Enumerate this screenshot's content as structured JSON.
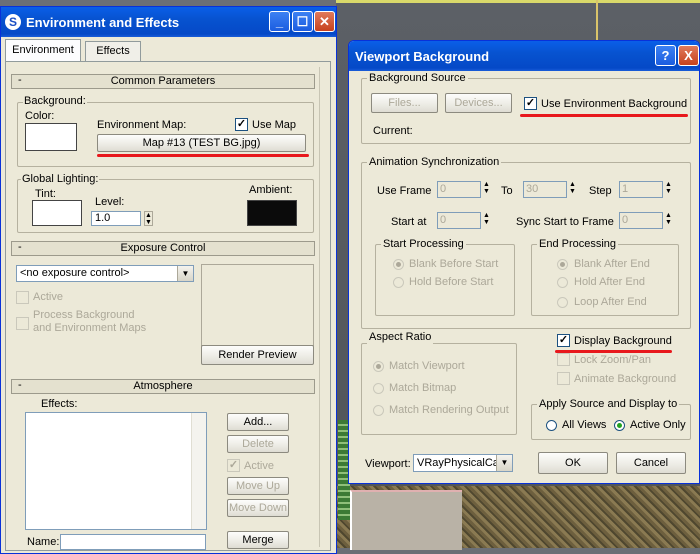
{
  "env": {
    "title": "Environment and Effects",
    "tabs": [
      "Environment",
      "Effects"
    ],
    "common": {
      "header": "Common Parameters",
      "background": "Background:",
      "color": "Color:",
      "env_map": "Environment Map:",
      "use_map": "Use Map",
      "map_button": "Map #13 (TEST BG.jpg)",
      "global_lighting": "Global Lighting:",
      "tint": "Tint:",
      "level": "Level:",
      "level_value": "1.0",
      "ambient": "Ambient:"
    },
    "exposure": {
      "header": "Exposure Control",
      "select": "<no exposure control>",
      "active": "Active",
      "process_bg": "Process Background",
      "and_env": "and Environment Maps",
      "render_preview": "Render Preview"
    },
    "atmosphere": {
      "header": "Atmosphere",
      "effects": "Effects:",
      "add": "Add...",
      "delete": "Delete",
      "active": "Active",
      "move_up": "Move Up",
      "move_down": "Move Down",
      "name": "Name:",
      "merge": "Merge"
    }
  },
  "vb": {
    "title": "Viewport Background",
    "help": "?",
    "close": "X",
    "bg_source": {
      "title": "Background Source",
      "files": "Files...",
      "devices": "Devices...",
      "use_env": "Use Environment Background",
      "current": "Current:"
    },
    "anim_sync": {
      "title": "Animation Synchronization",
      "use_frame": "Use Frame",
      "use_frame_val": "0",
      "to": "To",
      "to_val": "30",
      "step": "Step",
      "step_val": "1",
      "start_at": "Start at",
      "start_at_val": "0",
      "sync_start": "Sync Start to Frame",
      "sync_start_val": "0",
      "start_processing": "Start Processing",
      "blank_before": "Blank Before Start",
      "hold_before": "Hold Before Start",
      "end_processing": "End Processing",
      "blank_after": "Blank After End",
      "hold_after": "Hold After End",
      "loop_after": "Loop After End"
    },
    "aspect": {
      "title": "Aspect Ratio",
      "match_viewport": "Match Viewport",
      "match_bitmap": "Match Bitmap",
      "match_render": "Match Rendering Output"
    },
    "display_bg": "Display Background",
    "lock_zoom": "Lock Zoom/Pan",
    "animate_bg": "Animate Background",
    "apply": {
      "title": "Apply Source and Display to",
      "all_views": "All Views",
      "active_only": "Active Only"
    },
    "viewport_label": "Viewport:",
    "viewport_value": "VRayPhysicalCar",
    "ok": "OK",
    "cancel": "Cancel"
  }
}
